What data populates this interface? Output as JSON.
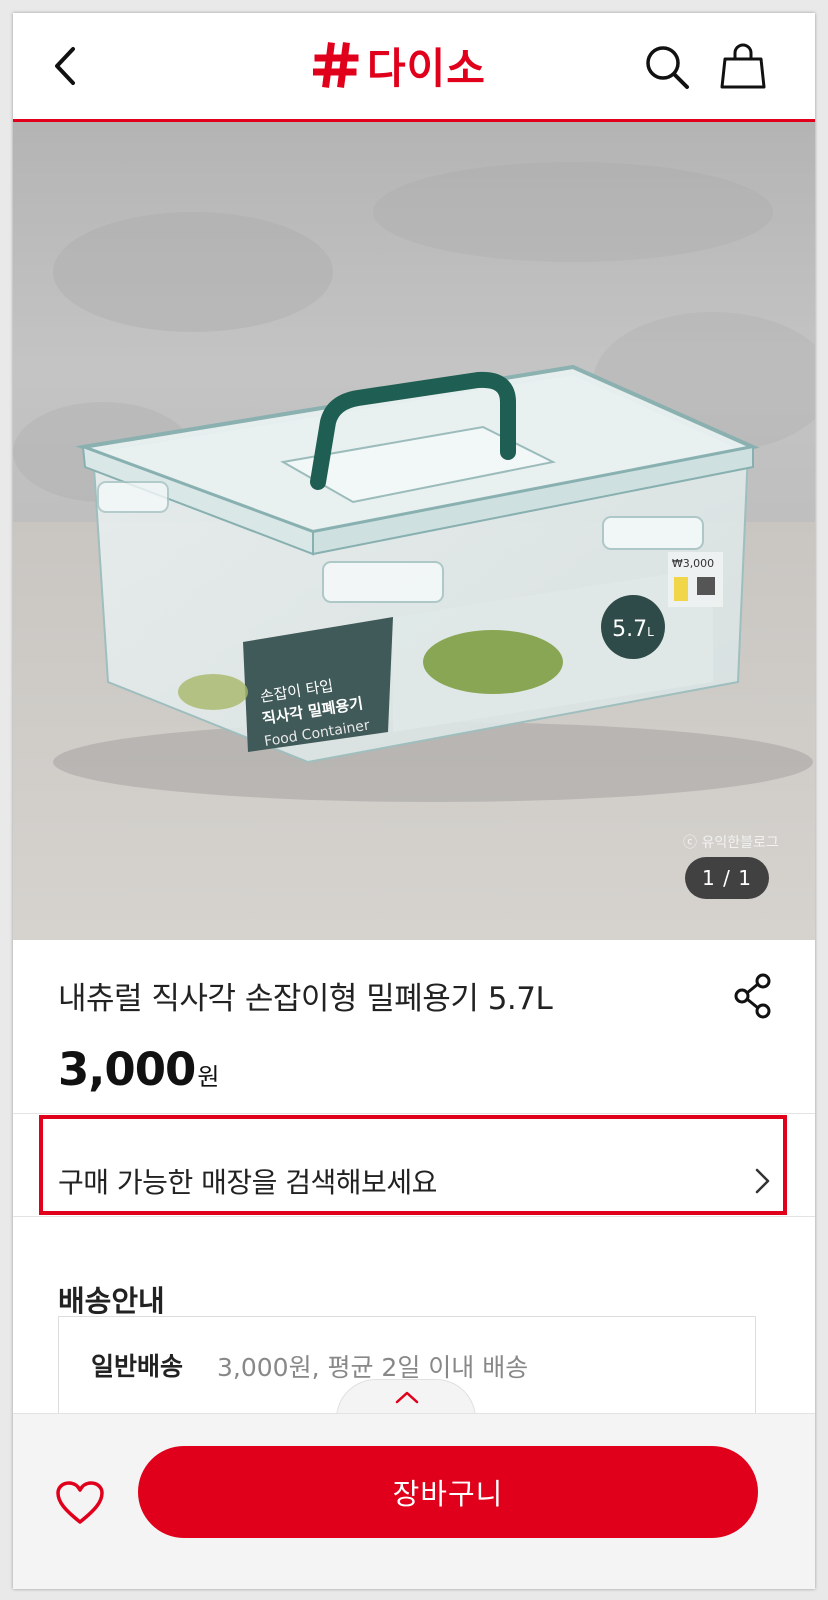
{
  "header": {
    "logo_text": "다이소",
    "back_icon": "chevron-left-icon",
    "search_icon": "search-icon",
    "bag_icon": "shopping-bag-icon",
    "brand_color": "#e0001b"
  },
  "hero": {
    "image_counter": "1 / 1",
    "watermark": "ⓒ 유익한블로그",
    "product_label": {
      "line1": "손잡이 타입",
      "line2": "직사각 밀폐용기",
      "line3": "Food Container",
      "capacity": "5.7",
      "capacity_unit": "L",
      "price_tag": "₩3,000"
    }
  },
  "product": {
    "title": "내츄럴 직사각 손잡이형 밀폐용기 5.7L",
    "price": "3,000",
    "price_unit": "원",
    "share_icon": "share-icon"
  },
  "store_search": {
    "label": "구매 가능한 매장을 검색해보세요"
  },
  "shipping": {
    "section_title": "배송안내",
    "type": "일반배송",
    "description": "3,000원, 평균 2일 이내 배송"
  },
  "bottom_bar": {
    "heart_icon": "heart-icon",
    "cart_label": "장바구니"
  }
}
